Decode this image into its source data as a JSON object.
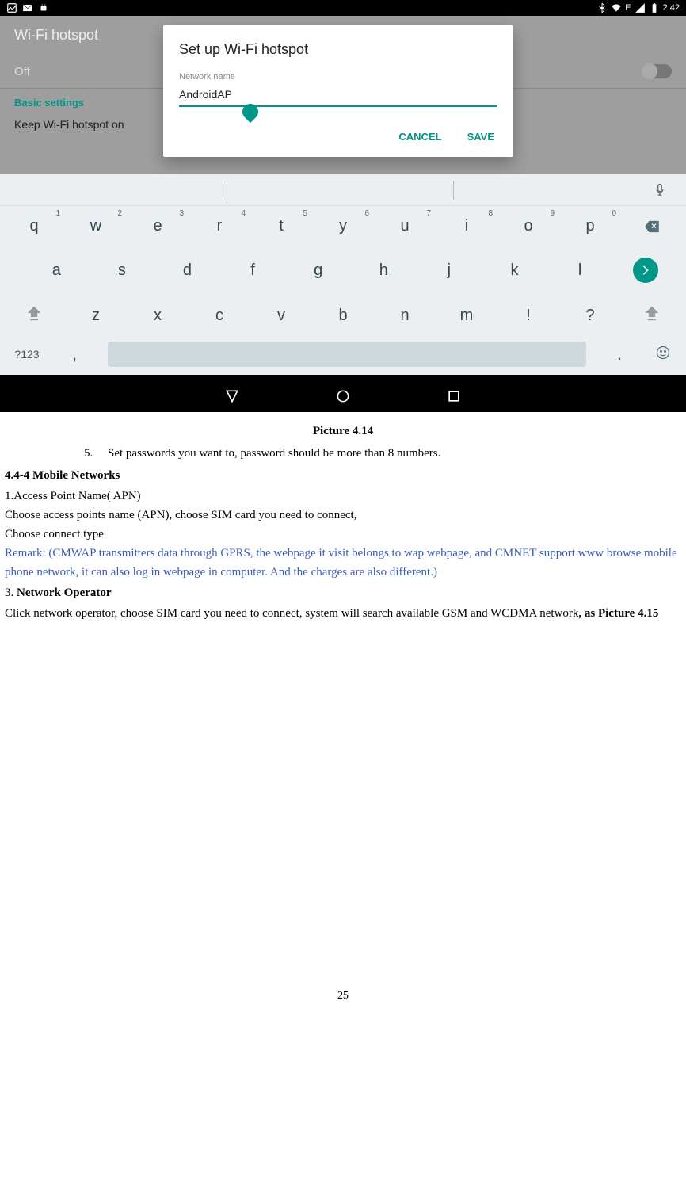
{
  "status": {
    "time": "2:42",
    "signal": "E"
  },
  "settings": {
    "title": "Wi-Fi hotspot",
    "off_label": "Off",
    "basic": "Basic settings",
    "keep": "Keep Wi-Fi hotspot on"
  },
  "dialog": {
    "title": "Set up Wi-Fi hotspot",
    "label": "Network name",
    "value": "AndroidAP",
    "cancel": "CANCEL",
    "save": "SAVE"
  },
  "keyboard": {
    "row1": [
      {
        "k": "q",
        "s": "1"
      },
      {
        "k": "w",
        "s": "2"
      },
      {
        "k": "e",
        "s": "3"
      },
      {
        "k": "r",
        "s": "4"
      },
      {
        "k": "t",
        "s": "5"
      },
      {
        "k": "y",
        "s": "6"
      },
      {
        "k": "u",
        "s": "7"
      },
      {
        "k": "i",
        "s": "8"
      },
      {
        "k": "o",
        "s": "9"
      },
      {
        "k": "p",
        "s": "0"
      }
    ],
    "row2": [
      "a",
      "s",
      "d",
      "f",
      "g",
      "h",
      "j",
      "k",
      "l"
    ],
    "row3": [
      "z",
      "x",
      "c",
      "v",
      "b",
      "n",
      "m",
      "!",
      "?"
    ],
    "symbol": "?123",
    "comma": ",",
    "period": "."
  },
  "doc": {
    "caption": "Picture 4.14",
    "item5_num": "5.",
    "item5": "Set passwords you want to, password should be more than 8 numbers.",
    "heading1": "4.4-4 Mobile Networks",
    "line1": "1.Access Point Name( APN)",
    "line2": "Choose access points name (APN), choose SIM card you need to connect,",
    "line3": "Choose connect type",
    "remark": "Remark: (CMWAP transmitters data through GPRS, the webpage it visit belongs to wap webpage, and CMNET support www browse mobile phone network, it can also log in webpage in computer. And the charges are also different.)",
    "section3_num": "3.",
    "section3_title": "Network Operator",
    "line4a": "Click network operator, choose SIM card you need to connect, system will search available GSM and WCDMA network",
    "line4b": ", as Picture 4.15",
    "page": "25"
  }
}
